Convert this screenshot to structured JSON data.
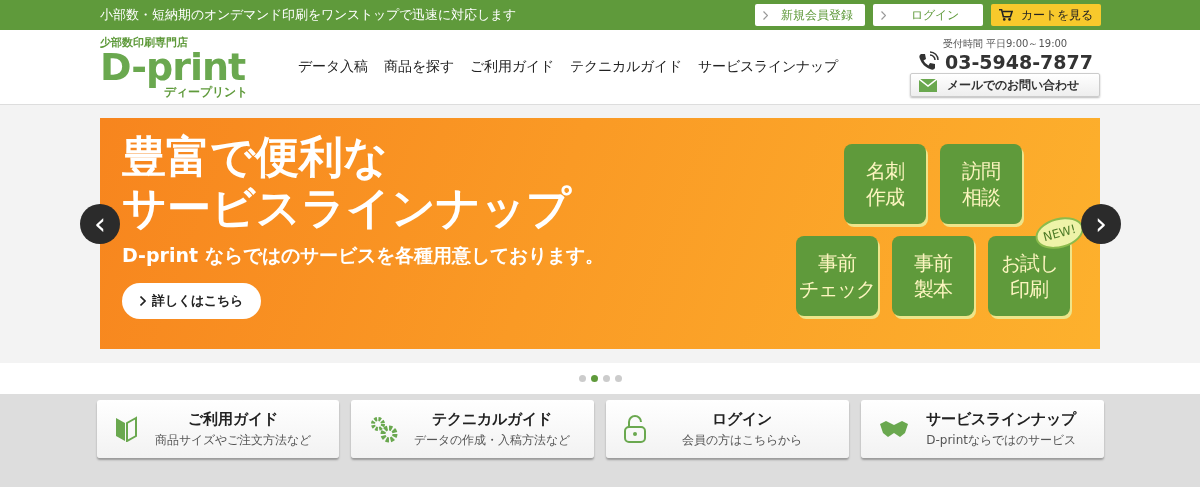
{
  "top_bar": {
    "tagline": "小部数・短納期のオンデマンド印刷をワンストップで迅速に対応します",
    "links": [
      {
        "kind": "link",
        "label": "新規会員登録"
      },
      {
        "kind": "link",
        "label": "ログイン"
      },
      {
        "kind": "cart",
        "label": "カートを見る"
      }
    ]
  },
  "header": {
    "logo": {
      "tagline": "少部数印刷専門店",
      "name": "D-print",
      "reading": "ディープリント"
    },
    "nav": [
      "データ入稿",
      "商品を探す",
      "ご利用ガイド",
      "テクニカルガイド",
      "サービスラインナップ"
    ],
    "contact": {
      "hours": "受付時間 平日9:00～19:00",
      "phone": "03-5948-7877",
      "mail_button": "メールでのお問い合わせ"
    }
  },
  "slider": {
    "prev": "‹",
    "next": "›",
    "banner": {
      "title_lines": [
        "豊富で便利な",
        "サービスラインナップ"
      ],
      "subtitle": "D-print ならではのサービスを各種用意しております。",
      "button": "詳しくはこちら",
      "tiles": [
        {
          "lines": [
            "名刺",
            "作成"
          ]
        },
        {
          "lines": [
            "訪問",
            "相談"
          ]
        },
        {
          "lines": [
            "事前",
            "チェック"
          ]
        },
        {
          "lines": [
            "事前",
            "製本"
          ]
        },
        {
          "lines": [
            "お試し",
            "印刷"
          ]
        }
      ],
      "badge": "NEW!"
    },
    "slides": [
      {
        "selected": false
      },
      {
        "selected": true
      },
      {
        "selected": false
      },
      {
        "selected": false
      }
    ]
  },
  "cards": [
    {
      "kind": "guide",
      "title": "ご利用ガイド",
      "subtitle": "商品サイズやご注文方法など"
    },
    {
      "kind": "technical",
      "title": "テクニカルガイド",
      "subtitle": "データの作成・入稿方法など"
    },
    {
      "kind": "login",
      "title": "ログイン",
      "subtitle": "会員の方はこちらから"
    },
    {
      "kind": "service",
      "title": "サービスラインナップ",
      "subtitle": "D-printならではのサービス"
    }
  ]
}
